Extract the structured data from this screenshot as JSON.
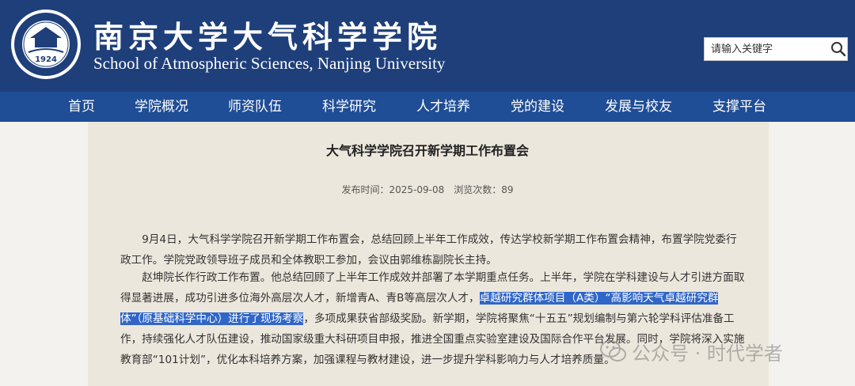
{
  "header": {
    "title_cn": "南京大学大气科学学院",
    "title_en": "School of Atmospheric Sciences, Nanjing University",
    "logo_text": "1924"
  },
  "search": {
    "placeholder": "请输入关键字",
    "icon": "search-icon"
  },
  "nav": {
    "items": [
      {
        "label": "首页"
      },
      {
        "label": "学院概况"
      },
      {
        "label": "师资队伍"
      },
      {
        "label": "科学研究"
      },
      {
        "label": "人才培养"
      },
      {
        "label": "党的建设"
      },
      {
        "label": "发展与校友"
      },
      {
        "label": "支撑平台"
      }
    ]
  },
  "article": {
    "title": "大气科学学院召开新学期工作布置会",
    "meta": "发布时间：2025-09-08　浏览次数：89",
    "p1": "9月4日，大气科学学院召开新学期工作布置会，总结回顾上半年工作成效，传达学校新学期工作布置会精神，布置学院党委行政工作。学院党政领导班子成员和全体教职工参加，会议由郭维栋副院长主持。",
    "p2_before": "赵坤院长作行政工作布置。他总结回顾了上半年工作成效并部署了本学期重点任务。上半年，学院在学科建设与人才引进方面取得显著进展，成功引进多位海外高层次人才，新增青A、青B等高层次人才，",
    "p2_highlight": "卓越研究群体项目（A类）“高影响天气卓越研究群体”（原基础科学中心）进行了现场考察",
    "p2_after": "，多项成果获省部级奖励。新学期，学院将聚焦“十五五”规划编制与第六轮学科评估准备工作，持续强化人才队伍建设，推动国家级重大科研项目申报，推进全国重点实验室建设及国际合作平台发展。同时，学院将深入实施教育部“101计划”，优化本科培养方案，加强课程与教材建设，进一步提升学科影响力与人才培养质量。"
  },
  "watermark": {
    "text": "公众号 · 时代学者"
  },
  "colors": {
    "header": "#1e3f7a",
    "nav": "#1f4d96",
    "highlight": "#3066c8",
    "content_bg": "#ece7dc"
  }
}
